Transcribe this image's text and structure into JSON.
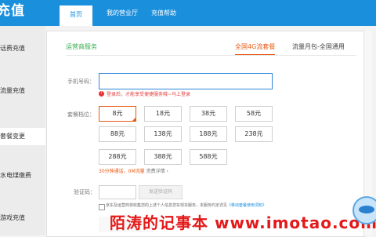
{
  "header": {
    "brand": "充值",
    "nav": [
      "首页",
      "我的营业厅",
      "充值帮助"
    ]
  },
  "sidebar": {
    "items": [
      "话费充值",
      "流量充值",
      "套餐变更",
      "水电煤缴费",
      "游戏充值"
    ]
  },
  "main": {
    "operator": "运营商服务",
    "tabs": [
      "全国4G流套餐",
      "流量月包-全国通用"
    ],
    "phone_label": "手机号码：",
    "phone_value": "",
    "tip": "登录后，才能享受便捷服务哦~马上登录",
    "package_label": "套餐档位：",
    "packages": [
      "8元",
      "18元",
      "38元",
      "58元",
      "88元",
      "138元",
      "188元",
      "238元",
      "288元",
      "388元",
      "588元"
    ],
    "selected_package": "8元",
    "package_note": "30分钟通话，0M流量",
    "package_detail": "资费详情 ›",
    "code_label": "验证码：",
    "code_button": "发送验证码",
    "agree_text": "京东及运营商将收集您的上述个人信息您实现本服务，本服务约定详见",
    "agree_link": "《移动套餐使用须知》"
  },
  "watermark": "陌涛的记事本  www.imotao.com",
  "colors": {
    "header_bg": "#1a8fdc",
    "accent_orange": "#e55a14",
    "operator_green": "#3cae54",
    "tip_red": "#e24040",
    "watermark_red": "#e4191a"
  }
}
